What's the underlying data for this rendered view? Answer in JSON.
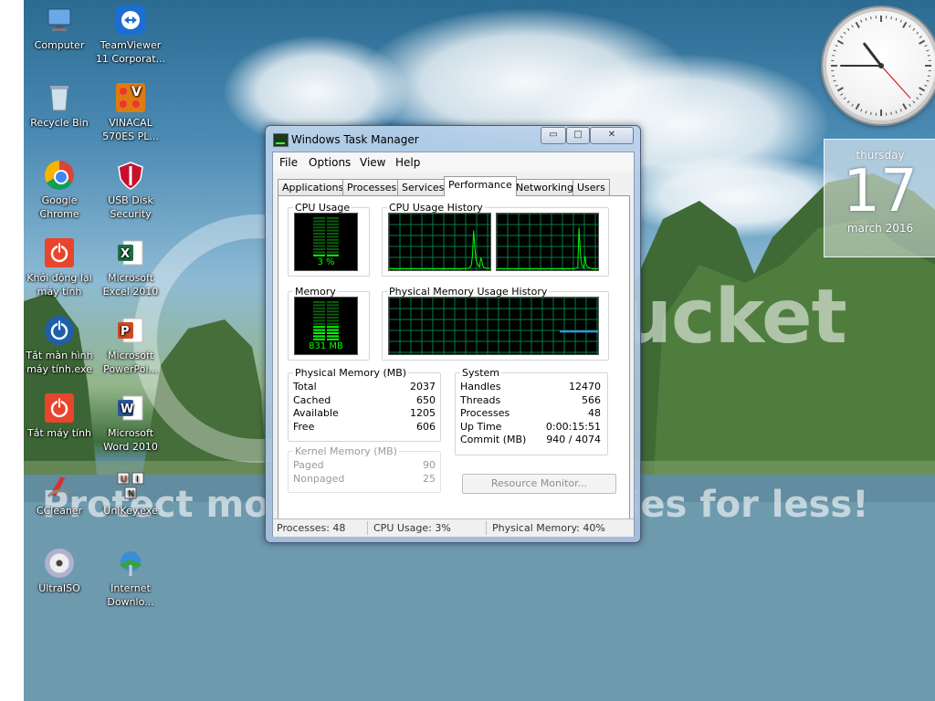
{
  "desktop": {
    "icons": [
      {
        "label1": "Computer",
        "label2": "",
        "icon": "computer-icon"
      },
      {
        "label1": "TeamViewer",
        "label2": "11 Corporat...",
        "icon": "teamviewer-icon"
      },
      {
        "label1": "Recycle Bin",
        "label2": "",
        "icon": "recycle-bin-icon"
      },
      {
        "label1": "VINACAL",
        "label2": "570ES PL...",
        "icon": "vinacal-icon"
      },
      {
        "label1": "Google",
        "label2": "Chrome",
        "icon": "chrome-icon"
      },
      {
        "label1": "USB Disk",
        "label2": "Security",
        "icon": "shield-icon"
      },
      {
        "label1": "Khởi động lại",
        "label2": "máy tính",
        "icon": "power-restart-icon"
      },
      {
        "label1": "Microsoft",
        "label2": "Excel 2010",
        "icon": "excel-icon"
      },
      {
        "label1": "Tắt màn hình",
        "label2": "máy tính.exe",
        "icon": "power-icon"
      },
      {
        "label1": "Microsoft",
        "label2": "PowerPoi...",
        "icon": "powerpoint-icon"
      },
      {
        "label1": "Tắt máy tính",
        "label2": "",
        "icon": "shutdown-icon"
      },
      {
        "label1": "Microsoft",
        "label2": "Word 2010",
        "icon": "word-icon"
      },
      {
        "label1": "CCleaner",
        "label2": "",
        "icon": "ccleaner-icon"
      },
      {
        "label1": "UniKey.exe",
        "label2": "",
        "icon": "unikey-icon"
      },
      {
        "label1": "UltraISO",
        "label2": "",
        "icon": "ultraiso-icon"
      },
      {
        "label1": "Internet",
        "label2": "Downlo...",
        "icon": "idm-icon"
      }
    ]
  },
  "watermark": {
    "logo": "photobucket",
    "tagline": "Protect more of your memories for less!"
  },
  "gadgets": {
    "calendar": {
      "weekday": "thursday",
      "day": "17",
      "month_year": "march 2016"
    },
    "clock": {
      "hour": 10,
      "minute": 45,
      "second": 23
    }
  },
  "task_manager": {
    "title": "Windows Task Manager",
    "window_buttons": {
      "minimize": "▭",
      "maximize": "□",
      "close": "✕"
    },
    "menu": [
      "File",
      "Options",
      "View",
      "Help"
    ],
    "tabs": [
      "Applications",
      "Processes",
      "Services",
      "Performance",
      "Networking",
      "Users"
    ],
    "active_tab": "Performance",
    "cpu_usage": {
      "label": "CPU Usage",
      "value": "3 %",
      "percent": 3
    },
    "cpu_history": {
      "label": "CPU Usage History",
      "core1": [
        2,
        2,
        3,
        2,
        2,
        3,
        2,
        2,
        2,
        2,
        3,
        2,
        2,
        3,
        2,
        2,
        2,
        2,
        3,
        2,
        2,
        2,
        3,
        2,
        2,
        2,
        2,
        3,
        2,
        2,
        2,
        2,
        3,
        2,
        2,
        2,
        3,
        2,
        2,
        2,
        2,
        3,
        2,
        2,
        2,
        2,
        3,
        2,
        2,
        2,
        2,
        3,
        2,
        2,
        2,
        2,
        3,
        2,
        2,
        2,
        2,
        2,
        3,
        3,
        2,
        3,
        3,
        4,
        5,
        8,
        25,
        70,
        40,
        18,
        12,
        8,
        6,
        22,
        15,
        6,
        5,
        4,
        3,
        4,
        3,
        3
      ],
      "core2": [
        2,
        2,
        2,
        2,
        3,
        2,
        2,
        2,
        3,
        2,
        2,
        2,
        2,
        3,
        2,
        2,
        2,
        2,
        2,
        3,
        2,
        2,
        2,
        2,
        3,
        2,
        2,
        2,
        2,
        3,
        2,
        2,
        2,
        3,
        2,
        2,
        2,
        2,
        3,
        2,
        2,
        2,
        2,
        3,
        2,
        2,
        2,
        2,
        2,
        3,
        2,
        2,
        2,
        2,
        3,
        2,
        2,
        2,
        2,
        3,
        2,
        2,
        3,
        3,
        2,
        3,
        3,
        4,
        5,
        75,
        35,
        12,
        6,
        5,
        25,
        10,
        6,
        5,
        4,
        3,
        3,
        2,
        3,
        2,
        2,
        3
      ]
    },
    "memory": {
      "label": "Memory",
      "value": "831 MB",
      "fraction": 0.41
    },
    "mem_history": {
      "label": "Physical Memory Usage History",
      "level_percent": 40
    },
    "physical_memory": {
      "label": "Physical Memory (MB)",
      "rows": [
        {
          "k": "Total",
          "v": "2037"
        },
        {
          "k": "Cached",
          "v": "650"
        },
        {
          "k": "Available",
          "v": "1205"
        },
        {
          "k": "Free",
          "v": "606"
        }
      ]
    },
    "kernel_memory": {
      "label": "Kernel Memory (MB)",
      "rows": [
        {
          "k": "Paged",
          "v": "90"
        },
        {
          "k": "Nonpaged",
          "v": "25"
        }
      ]
    },
    "system": {
      "label": "System",
      "rows": [
        {
          "k": "Handles",
          "v": "12470"
        },
        {
          "k": "Threads",
          "v": "566"
        },
        {
          "k": "Processes",
          "v": "48"
        },
        {
          "k": "Up Time",
          "v": "0:00:15:51"
        },
        {
          "k": "Commit (MB)",
          "v": "940 / 4074"
        }
      ]
    },
    "resource_monitor_button": "Resource Monitor...",
    "status": {
      "processes": "Processes: 48",
      "cpu": "CPU Usage: 3%",
      "memory": "Physical Memory: 40%"
    },
    "graph_color": "#00ff00",
    "grid_color": "#008040"
  }
}
